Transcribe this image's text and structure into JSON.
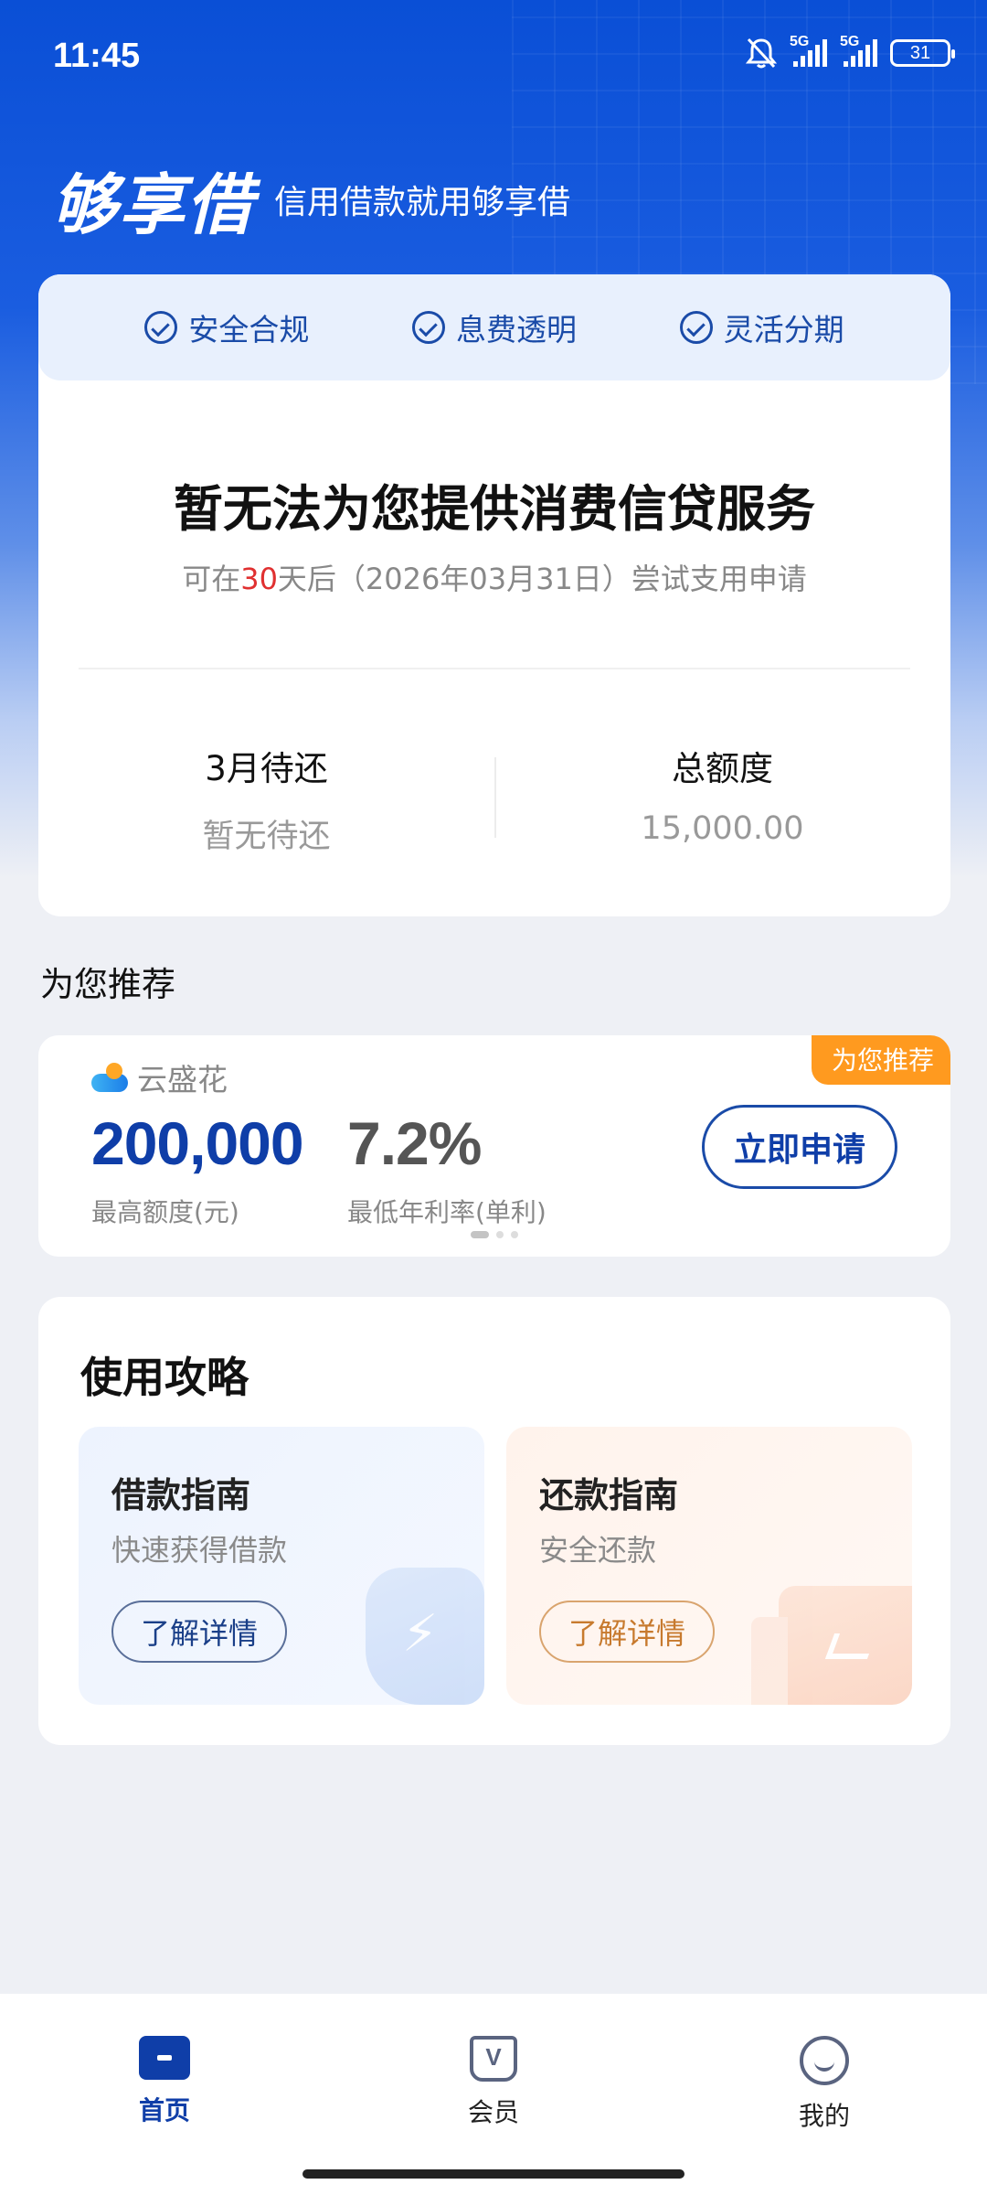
{
  "status_bar": {
    "time": "11:45",
    "icons": [
      "bell-off-icon",
      "signal-5g-icon",
      "signal-5g-icon"
    ],
    "sim1_label": "5G",
    "sim2_label": "5G",
    "battery": "31"
  },
  "brand": {
    "logo": "够享借",
    "slogan": "信用借款就用够享借"
  },
  "features": [
    {
      "label": "安全合规",
      "icon": "check-circle-icon"
    },
    {
      "label": "息费透明",
      "icon": "check-circle-icon"
    },
    {
      "label": "灵活分期",
      "icon": "check-circle-icon"
    }
  ],
  "status_card": {
    "title": "暂无法为您提供消费信贷服务",
    "sub_prefix": "可在",
    "sub_days": "30",
    "sub_suffix": "天后（2026年03月31日）尝试支用申请",
    "left_label": "3月待还",
    "left_value": "暂无待还",
    "right_label": "总额度",
    "right_value": "15,000.00"
  },
  "recommend": {
    "heading": "为您推荐",
    "tag": "为您推荐",
    "product_name": "云盛花",
    "amount": "200,000",
    "amount_label": "最高额度(元)",
    "rate": "7.2%",
    "rate_label": "最低年利率(单利)",
    "apply_button": "立即申请"
  },
  "guide": {
    "title": "使用攻略",
    "borrow": {
      "title": "借款指南",
      "subtitle": "快速获得借款",
      "button": "了解详情"
    },
    "repay": {
      "title": "还款指南",
      "subtitle": "安全还款",
      "button": "了解详情"
    }
  },
  "nav": {
    "home": "首页",
    "member": "会员",
    "me": "我的"
  },
  "colors": {
    "brand_blue": "#0f3ea8",
    "hero_blue": "#0a4fd6",
    "accent_red": "#e03030",
    "tag_orange": "#ff9a1f"
  }
}
